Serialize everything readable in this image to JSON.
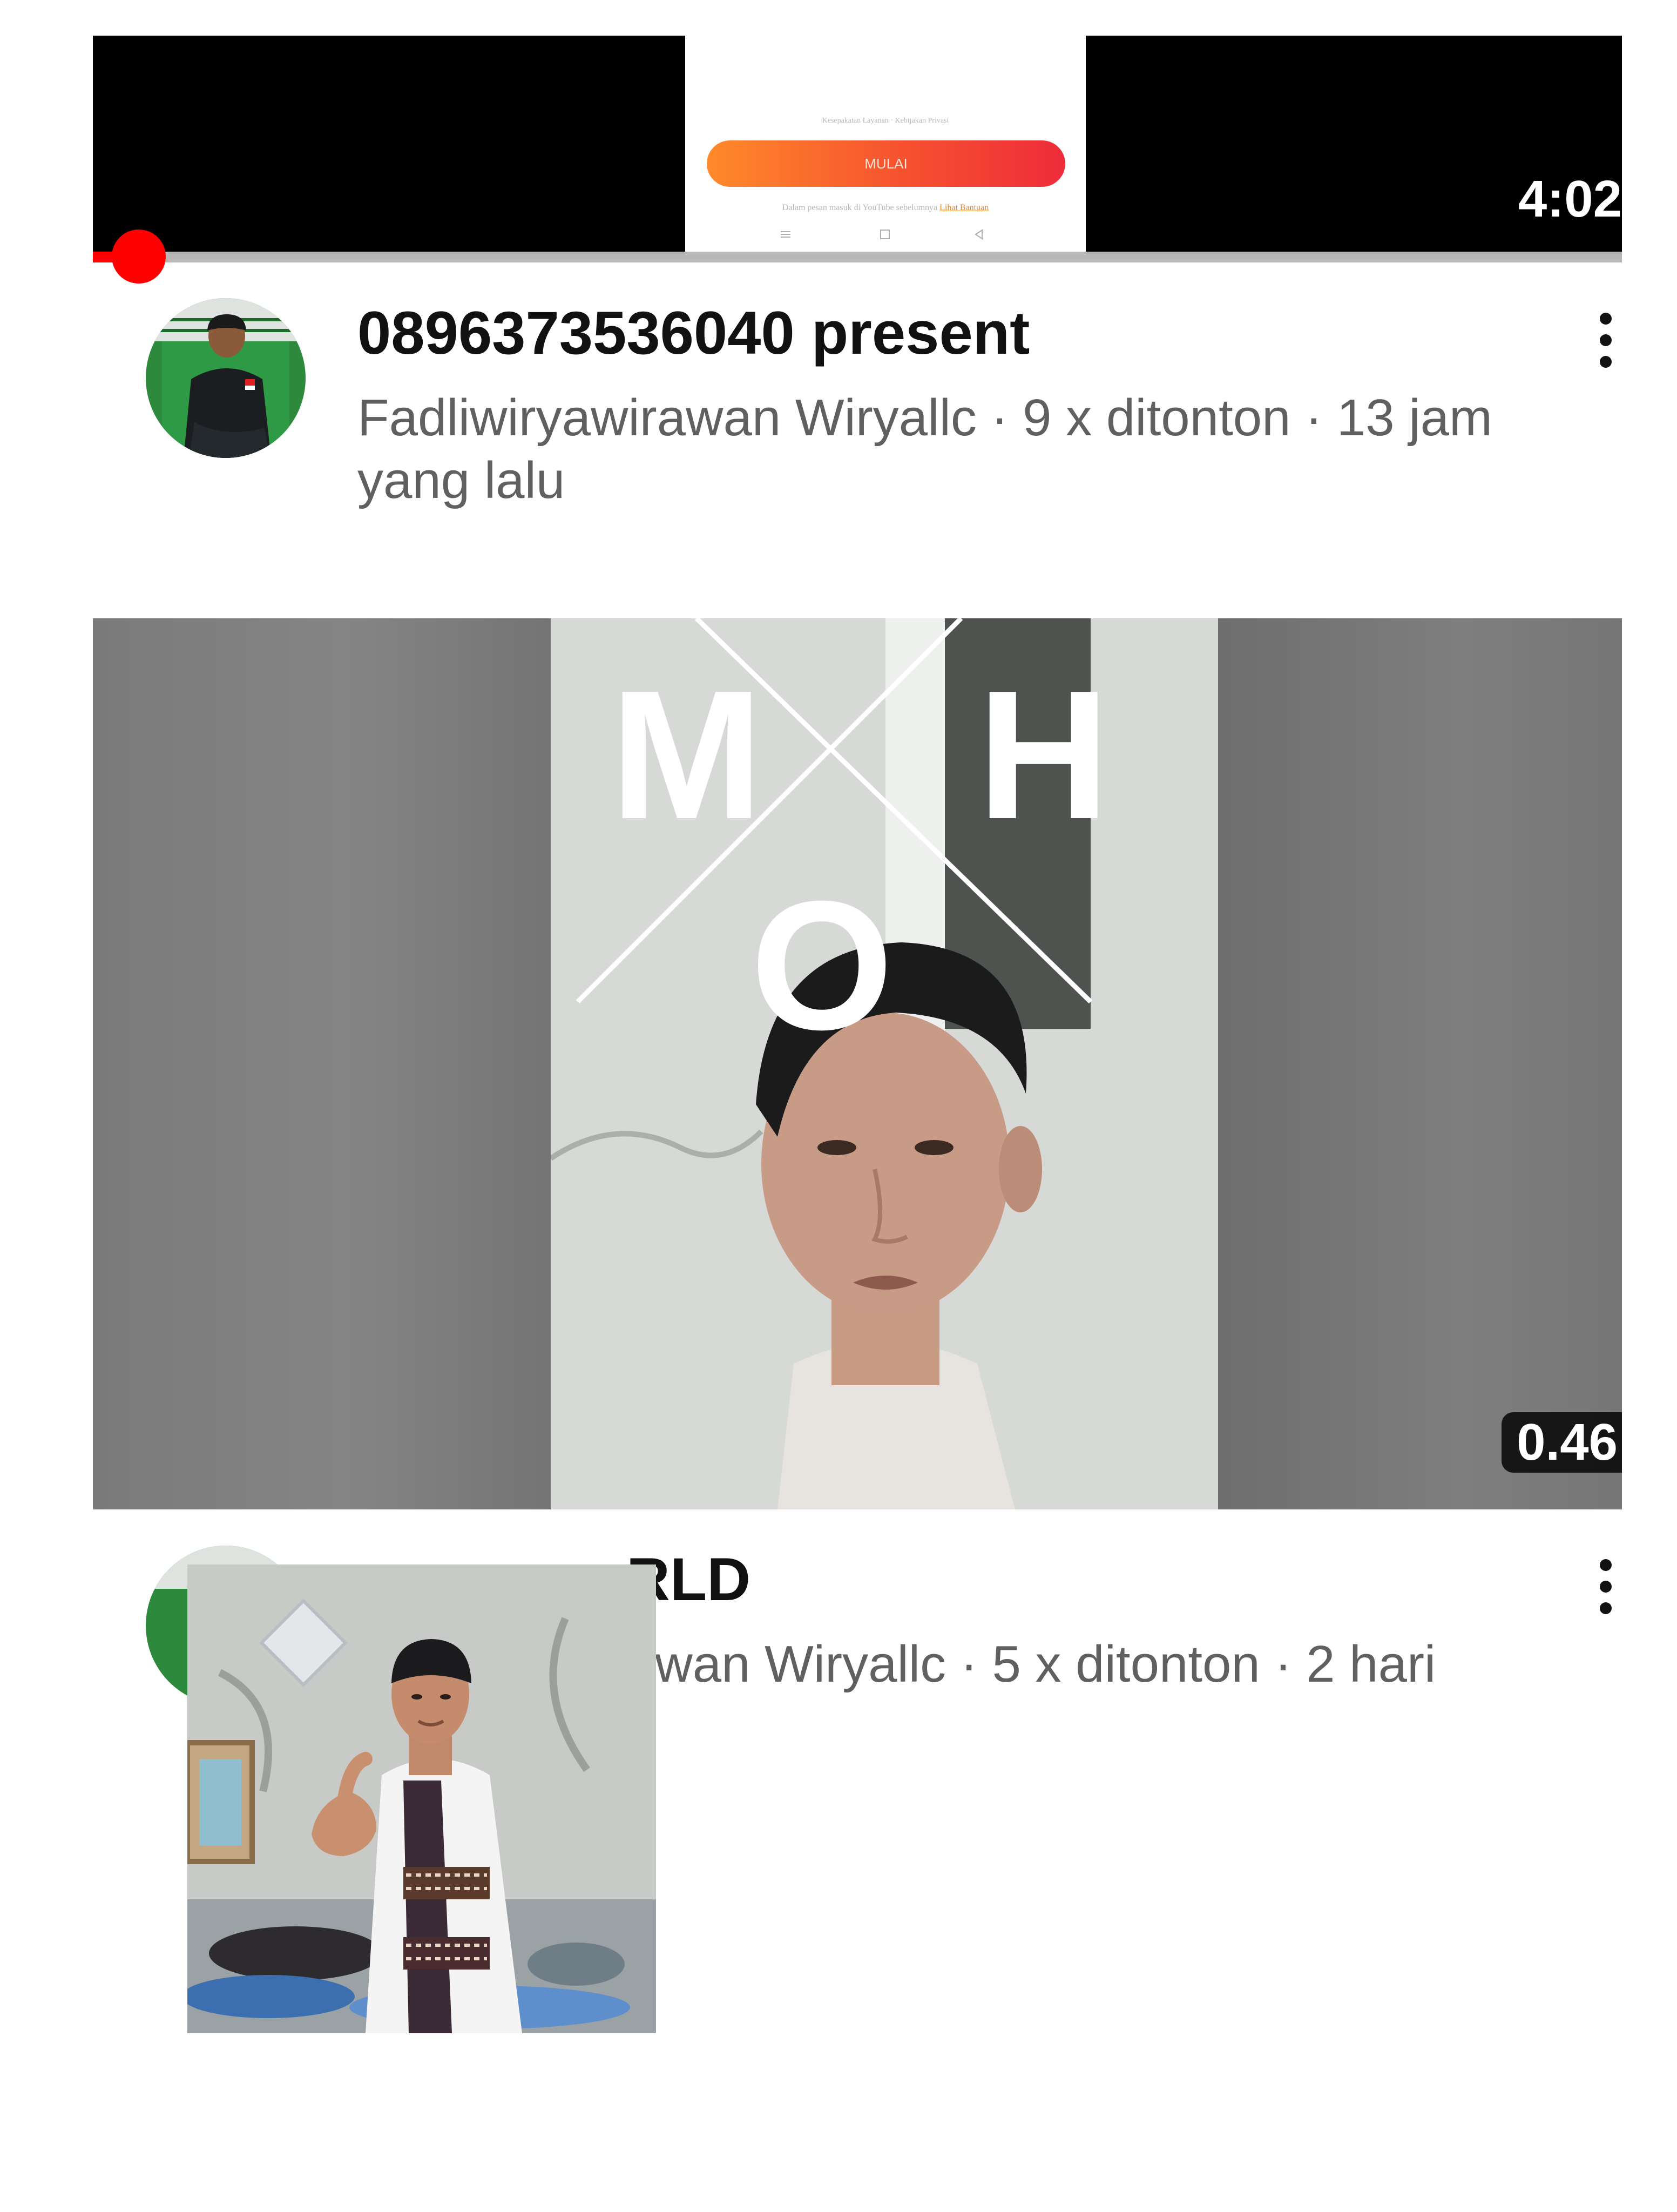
{
  "feed": {
    "videos": [
      {
        "title": "0896373536040 present",
        "channel": "Fadliwiryawirawan Wiryallc",
        "views": "9 x ditonton",
        "age": "13 jam yang lalu",
        "meta_line": "Fadliwiryawirawan Wiryallc · 9 x ditonton · 13 jam yang lalu",
        "duration": "4:02",
        "watch_progress": 0.03,
        "thumbnail_text": {
          "top_line": "Kesepakatan Layanan  ·  Kebijakan Privasi",
          "button_label": "MULAI",
          "help_line": "Dalam pesan masuk di YouTube sebelumnya",
          "help_link": "Lihat Bantuan"
        }
      },
      {
        "title_visible": "RLD",
        "meta_visible": "awan Wiryallc · 5 x ditonton · 2 hari",
        "duration": "0.46",
        "thumbnail_text": {
          "letter_m": "M",
          "letter_h": "H",
          "letter_o": "O"
        }
      }
    ]
  },
  "colors": {
    "progress_red": "#ff0000",
    "mulai_gradient_start": "#ff8a2a",
    "mulai_gradient_end": "#ee2c3a",
    "meta_gray": "#606060"
  },
  "icons": {
    "more_menu": "vertical-dots-icon",
    "nav_back": "triangle-back-icon",
    "nav_home": "square-home-icon",
    "nav_recent": "lines-recent-icon"
  }
}
